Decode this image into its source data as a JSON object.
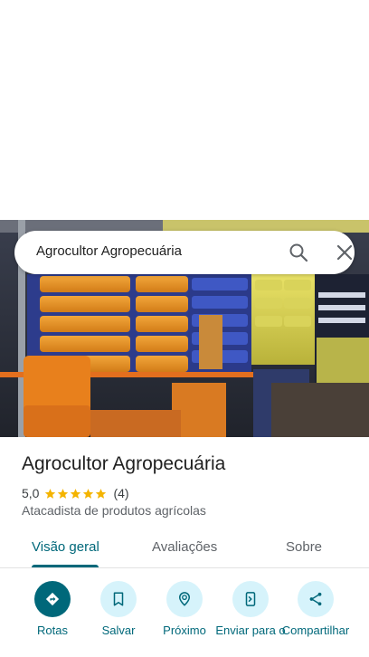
{
  "search": {
    "query": "Agrocultor Agropecuária"
  },
  "place": {
    "title": "Agrocultor Agropecuária",
    "rating_value": "5,0",
    "rating_stars": 5,
    "review_count": "(4)",
    "category": "Atacadista de produtos agrícolas"
  },
  "tabs": [
    {
      "label": "Visão geral",
      "active": true
    },
    {
      "label": "Avaliações",
      "active": false
    },
    {
      "label": "Sobre",
      "active": false
    }
  ],
  "actions": [
    {
      "label": "Rotas",
      "icon": "directions-icon"
    },
    {
      "label": "Salvar",
      "icon": "bookmark-icon"
    },
    {
      "label": "Próximo",
      "icon": "nearby-icon"
    },
    {
      "label": "Enviar para o",
      "icon": "send-to-phone-icon"
    },
    {
      "label": "Compartilhar",
      "icon": "share-icon"
    }
  ],
  "colors": {
    "accent": "#00687a",
    "action_bg": "#d6f3fb",
    "star": "#f4b400"
  }
}
